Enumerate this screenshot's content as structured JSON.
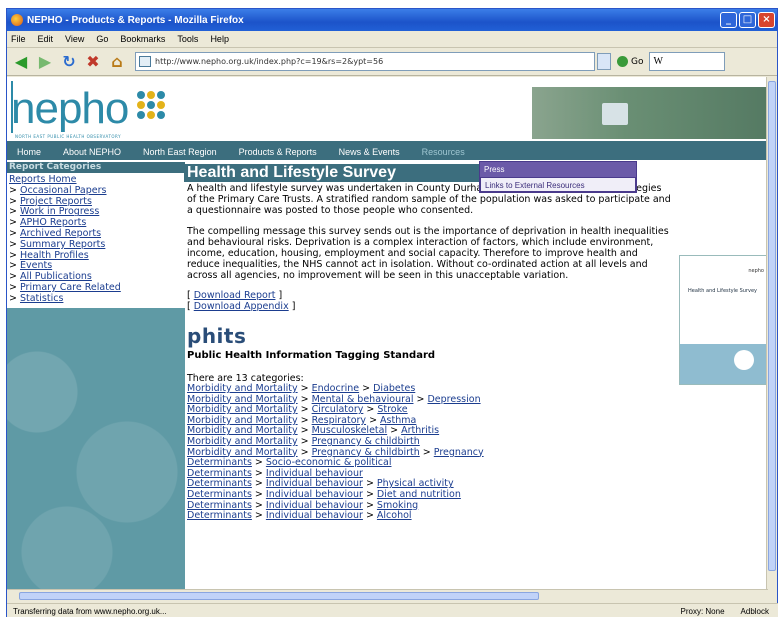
{
  "window": {
    "title": "NEPHO - Products & Reports - Mozilla Firefox"
  },
  "menubar": [
    "File",
    "Edit",
    "View",
    "Go",
    "Bookmarks",
    "Tools",
    "Help"
  ],
  "navbar": {
    "url": "http://www.nepho.org.uk/index.php?c=19&rs=2&ypt=56",
    "go_label": "Go",
    "search_value": "W"
  },
  "site": {
    "logo_text": "nepho",
    "logo_tagline": "NORTH EAST PUBLIC HEALTH OBSERVATORY",
    "nav": [
      "Home",
      "About NEPHO",
      "North East Region",
      "Products & Reports",
      "News & Events",
      "Resources"
    ],
    "dropdown": [
      "Press",
      "Links to External Resources"
    ]
  },
  "sidebar": {
    "heading": "Report Categories",
    "links": [
      "Reports Home",
      "Occasional Papers",
      "Project Reports",
      "Work in Progress",
      "APHO Reports",
      "Archived Reports",
      "Summary Reports",
      "Health Profiles",
      "Events",
      "All Publications",
      "Primary Care Related",
      "Statistics"
    ]
  },
  "content": {
    "title": "Health and Lifestyle Survey",
    "para1": "A health and lifestyle survey was undertaken in County Durham in order to inform health strategies of the Primary Care Trusts. A stratified random sample of the population was asked to participate and a questionnaire was posted to those people who consented.",
    "para2": "The compelling message this survey sends out is the importance of deprivation in health inequalities and behavioural risks. Deprivation is a complex interaction of factors, which include environment, income, education, housing, employment and social capacity. Therefore to improve health and reduce inequalities, the NHS cannot act in isolation. Without co-ordinated action at all levels and across all agencies, no improvement will be seen in this unacceptable variation.",
    "download_report": "Download Report",
    "download_appendix": "Download Appendix",
    "phits_logo": "phits",
    "phits_title": "Public Health Information Tagging Standard",
    "categories_intro": "There are 13 categories:",
    "categories": [
      [
        "Morbidity and Mortality",
        "Endocrine",
        "Diabetes"
      ],
      [
        "Morbidity and Mortality",
        "Mental & behavioural",
        "Depression"
      ],
      [
        "Morbidity and Mortality",
        "Circulatory",
        "Stroke"
      ],
      [
        "Morbidity and Mortality",
        "Respiratory",
        "Asthma"
      ],
      [
        "Morbidity and Mortality",
        "Musculoskeletal",
        "Arthritis"
      ],
      [
        "Morbidity and Mortality",
        "Pregnancy & childbirth"
      ],
      [
        "Morbidity and Mortality",
        "Pregnancy & childbirth",
        "Pregnancy"
      ],
      [
        "Determinants",
        "Socio-economic & political"
      ],
      [
        "Determinants",
        "Individual behaviour"
      ],
      [
        "Determinants",
        "Individual behaviour",
        "Physical activity"
      ],
      [
        "Determinants",
        "Individual behaviour",
        "Diet and nutrition"
      ],
      [
        "Determinants",
        "Individual behaviour",
        "Smoking"
      ],
      [
        "Determinants",
        "Individual behaviour",
        "Alcohol"
      ]
    ],
    "thumb_top": "nepho",
    "thumb_title": "Health and Lifestyle Survey"
  },
  "status": {
    "message": "Transferring data from www.nepho.org.uk...",
    "proxy": "Proxy: None",
    "adblock": "Adblock"
  }
}
